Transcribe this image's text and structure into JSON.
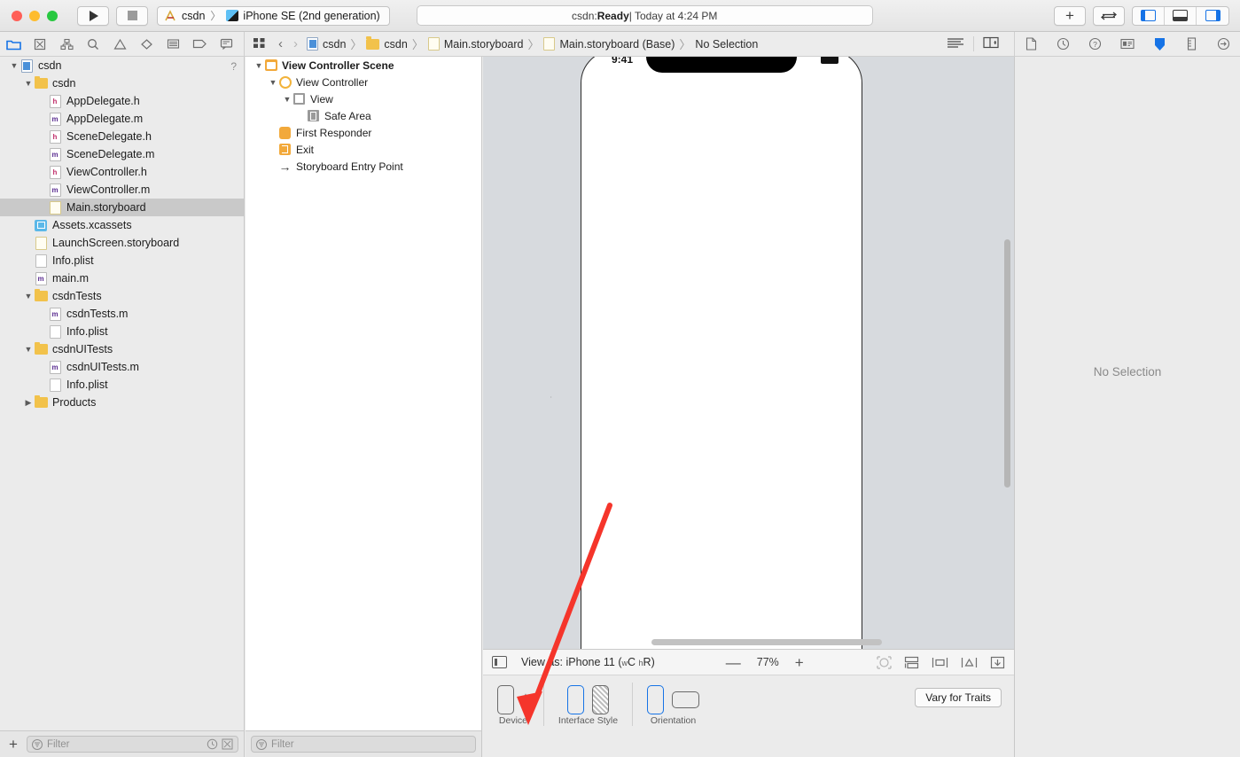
{
  "window": {
    "traffic_lights": [
      "close",
      "minimize",
      "zoom"
    ]
  },
  "toolbar": {
    "run_label": "Run",
    "stop_label": "Stop",
    "scheme": {
      "project": "csdn",
      "separator": "〉",
      "destination": "iPhone SE (2nd generation)"
    },
    "status": {
      "prefix": "csdn: ",
      "state": "Ready",
      "suffix": " | Today at 4:24 PM"
    },
    "add_label": "+",
    "toggle_label": "⇄",
    "panels": [
      "navigator-toggle",
      "debug-area-toggle",
      "inspector-toggle"
    ]
  },
  "navigator_tabs": [
    {
      "name": "project-navigator",
      "active": true
    },
    {
      "name": "source-control-navigator",
      "active": false
    },
    {
      "name": "symbol-navigator",
      "active": false
    },
    {
      "name": "find-navigator",
      "active": false
    },
    {
      "name": "issue-navigator",
      "active": false
    },
    {
      "name": "test-navigator",
      "active": false
    },
    {
      "name": "debug-navigator",
      "active": false
    },
    {
      "name": "breakpoint-navigator",
      "active": false
    },
    {
      "name": "report-navigator",
      "active": false
    }
  ],
  "jump_bar": {
    "items": [
      {
        "label": "csdn",
        "icon": "project-icon"
      },
      {
        "label": "csdn",
        "icon": "folder-icon"
      },
      {
        "label": "Main.storyboard",
        "icon": "storyboard-icon"
      },
      {
        "label": "Main.storyboard (Base)",
        "icon": "storyboard-icon"
      },
      {
        "label": "No Selection",
        "icon": "none"
      }
    ],
    "separator": "〉"
  },
  "inspector_tabs": [
    "file-inspector",
    "history-inspector",
    "quick-help-inspector",
    "identity-inspector",
    "attributes-inspector",
    "size-inspector",
    "connections-inspector"
  ],
  "navigator": {
    "help_glyph": "?",
    "tree": [
      {
        "label": "csdn",
        "indent": 0,
        "icon": "project",
        "disclosure": "open",
        "selected": false
      },
      {
        "label": "csdn",
        "indent": 1,
        "icon": "folder",
        "disclosure": "open",
        "selected": false
      },
      {
        "label": "AppDelegate.h",
        "indent": 2,
        "icon": "h",
        "disclosure": "none",
        "selected": false
      },
      {
        "label": "AppDelegate.m",
        "indent": 2,
        "icon": "m",
        "disclosure": "none",
        "selected": false
      },
      {
        "label": "SceneDelegate.h",
        "indent": 2,
        "icon": "h",
        "disclosure": "none",
        "selected": false
      },
      {
        "label": "SceneDelegate.m",
        "indent": 2,
        "icon": "m",
        "disclosure": "none",
        "selected": false
      },
      {
        "label": "ViewController.h",
        "indent": 2,
        "icon": "h",
        "disclosure": "none",
        "selected": false
      },
      {
        "label": "ViewController.m",
        "indent": 2,
        "icon": "m",
        "disclosure": "none",
        "selected": false
      },
      {
        "label": "Main.storyboard",
        "indent": 2,
        "icon": "storyboard",
        "disclosure": "none",
        "selected": true
      },
      {
        "label": "Assets.xcassets",
        "indent": 1,
        "icon": "assets",
        "disclosure": "none",
        "selected": false
      },
      {
        "label": "LaunchScreen.storyboard",
        "indent": 1,
        "icon": "storyboard",
        "disclosure": "none",
        "selected": false
      },
      {
        "label": "Info.plist",
        "indent": 1,
        "icon": "plist",
        "disclosure": "none",
        "selected": false
      },
      {
        "label": "main.m",
        "indent": 1,
        "icon": "m",
        "disclosure": "none",
        "selected": false
      },
      {
        "label": "csdnTests",
        "indent": 1,
        "icon": "folder",
        "disclosure": "open",
        "selected": false
      },
      {
        "label": "csdnTests.m",
        "indent": 2,
        "icon": "m",
        "disclosure": "none",
        "selected": false
      },
      {
        "label": "Info.plist",
        "indent": 2,
        "icon": "plist",
        "disclosure": "none",
        "selected": false
      },
      {
        "label": "csdnUITests",
        "indent": 1,
        "icon": "folder",
        "disclosure": "open",
        "selected": false
      },
      {
        "label": "csdnUITests.m",
        "indent": 2,
        "icon": "m",
        "disclosure": "none",
        "selected": false
      },
      {
        "label": "Info.plist",
        "indent": 2,
        "icon": "plist",
        "disclosure": "none",
        "selected": false
      },
      {
        "label": "Products",
        "indent": 1,
        "icon": "folder",
        "disclosure": "closed",
        "selected": false
      }
    ]
  },
  "outline": {
    "rows": [
      {
        "label": "View Controller Scene",
        "indent": 0,
        "icon": "scene",
        "disclosure": "open",
        "bold": true
      },
      {
        "label": "View Controller",
        "indent": 1,
        "icon": "viewcontroller",
        "disclosure": "open",
        "bold": false
      },
      {
        "label": "View",
        "indent": 2,
        "icon": "view",
        "disclosure": "open",
        "bold": false
      },
      {
        "label": "Safe Area",
        "indent": 3,
        "icon": "safearea",
        "disclosure": "none",
        "bold": false
      },
      {
        "label": "First Responder",
        "indent": 1,
        "icon": "firstresponder",
        "disclosure": "none",
        "bold": false
      },
      {
        "label": "Exit",
        "indent": 1,
        "icon": "exit",
        "disclosure": "none",
        "bold": false
      },
      {
        "label": "Storyboard Entry Point",
        "indent": 1,
        "icon": "entrypoint",
        "disclosure": "none",
        "bold": false
      }
    ]
  },
  "canvas": {
    "device_preview": {
      "status_time": "9:41"
    },
    "bottom_bar": {
      "view_as_prefix": "View as: ",
      "view_as_device": "iPhone 11 ",
      "view_as_traits_open": "(",
      "trait_w": "w",
      "trait_wc": "C ",
      "trait_h": "h",
      "trait_hr": "R",
      "view_as_traits_close": ")",
      "zoom_out": "—",
      "zoom_level": "77%",
      "zoom_in": "+",
      "tools": [
        "update-frames",
        "embed-in",
        "align",
        "add-constraints",
        "resolve-issues"
      ]
    }
  },
  "trait_bar": {
    "sections": [
      {
        "label": "Device",
        "name": "device"
      },
      {
        "label": "Interface Style",
        "name": "interface-style"
      },
      {
        "label": "Orientation",
        "name": "orientation"
      }
    ],
    "vary_button": "Vary for Traits"
  },
  "inspector": {
    "empty_message": "No Selection"
  },
  "filters": {
    "left_placeholder": "Filter",
    "mid_placeholder": "Filter",
    "add_label": "+"
  },
  "colors": {
    "accent_blue": "#1673e6",
    "folder_yellow": "#f2c24b",
    "scene_orange": "#f2a93b",
    "annotation_red": "#f5352b",
    "selection_gray": "#c9c9c9",
    "canvas_bg": "#d7dade"
  }
}
